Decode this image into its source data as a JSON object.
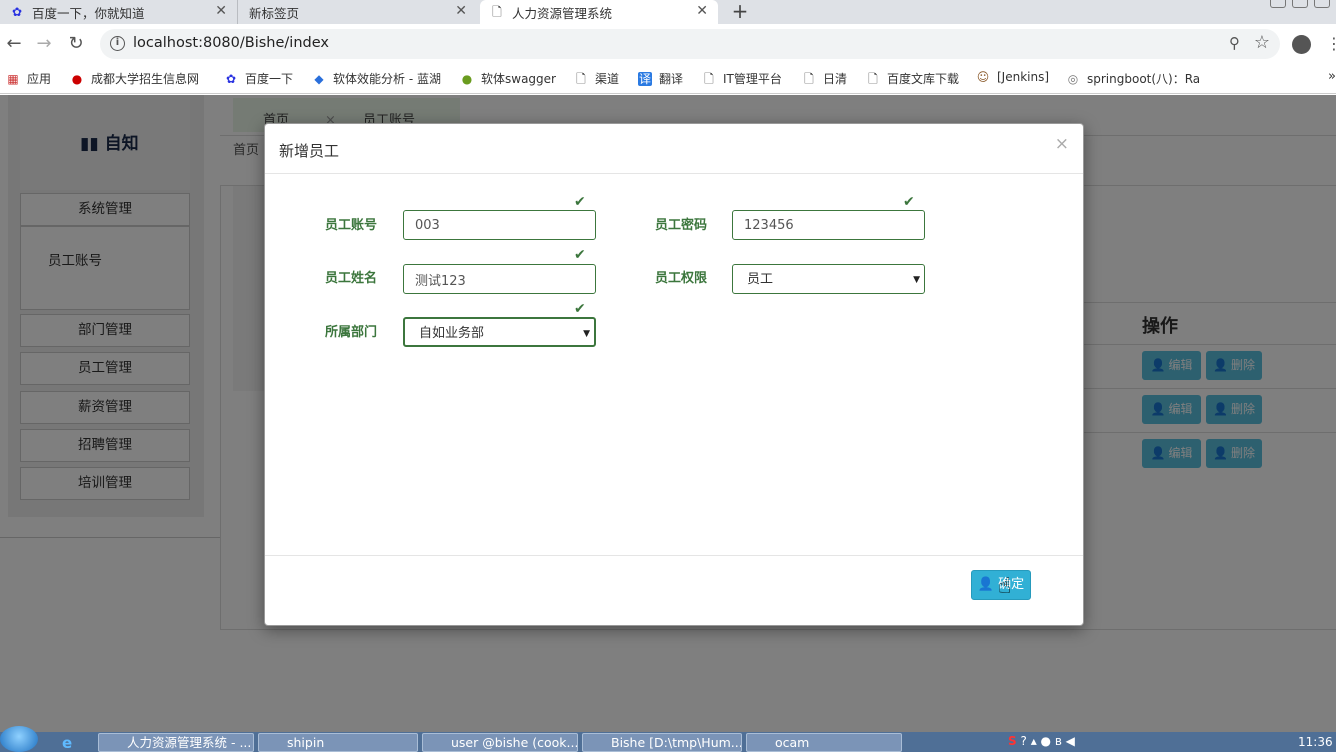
{
  "browser": {
    "tabs": [
      {
        "title": "百度一下，你就知道",
        "icon": "paw-icon"
      },
      {
        "title": "新标签页",
        "icon": "none"
      },
      {
        "title": "人力资源管理系统",
        "icon": "page-icon"
      }
    ],
    "url": "localhost:8080/Bishe/index",
    "bookmarks": [
      "应用",
      "成都大学招生信息网",
      "百度一下",
      "软体效能分析 - 蓝湖",
      "软体swagger",
      "渠道",
      "翻译",
      "IT管理平台",
      "日清",
      "百度文库下载",
      "[Jenkins]",
      "springboot(八)：Ra"
    ]
  },
  "app": {
    "logo": "自知",
    "menu": {
      "system": "系统管理",
      "sub_account": "员工账号",
      "department": "部门管理",
      "employee": "员工管理",
      "salary": "薪资管理",
      "recruit": "招聘管理",
      "training": "培训管理"
    },
    "content_tabs": [
      "首页",
      "员工账号"
    ],
    "breadcrumb": "首页",
    "table_ops_header": "操作",
    "edit_label": "编辑",
    "delete_label": "删除"
  },
  "modal": {
    "title": "新增员工",
    "close": "×",
    "fields": {
      "account_label": "员工账号",
      "account_value": "003",
      "password_label": "员工密码",
      "password_value": "123456",
      "name_label": "员工姓名",
      "name_value": "测试123",
      "role_label": "员工权限",
      "role_value": "员工",
      "dept_label": "所属部门",
      "dept_value": "自如业务部"
    },
    "confirm": "确定"
  },
  "taskbar": {
    "items": [
      "人力资源管理系统 - ...",
      "shipin",
      "user @bishe (cook...",
      "Bishe [D:\\tmp\\Hum...",
      "ocam"
    ],
    "clock": "11:36"
  }
}
